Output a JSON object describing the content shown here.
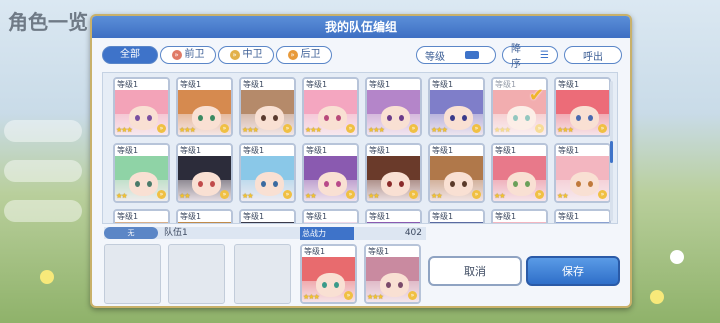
{
  "background": {
    "title": "角色一览"
  },
  "dialog": {
    "title": "我的队伍编组"
  },
  "filter_tabs": [
    {
      "label": "全部",
      "icon": "",
      "active": true
    },
    {
      "label": "前卫",
      "icon": "front-position-icon",
      "active": false
    },
    {
      "label": "中卫",
      "icon": "middle-position-icon",
      "active": false
    },
    {
      "label": "后卫",
      "icon": "back-position-icon",
      "active": false
    }
  ],
  "sort": {
    "sort_by_label": "等级",
    "order_label": "降序",
    "call_out_label": "呼出"
  },
  "level_label": "等级1",
  "character_grid": [
    {
      "hair": "#f3a3b8",
      "eye": "#7a4fa0",
      "stars": "★★★",
      "selected": false
    },
    {
      "hair": "#d68a4f",
      "eye": "#3a8a62",
      "stars": "★★★",
      "selected": false
    },
    {
      "hair": "#b58a6a",
      "eye": "#5a3a2e",
      "stars": "★★★",
      "selected": false
    },
    {
      "hair": "#f4a6c0",
      "eye": "#b84a7a",
      "stars": "★★★",
      "selected": false
    },
    {
      "hair": "#b485c9",
      "eye": "#6b3b8a",
      "stars": "★★★",
      "selected": false
    },
    {
      "hair": "#7f7ec9",
      "eye": "#3a3a8a",
      "stars": "★★★",
      "selected": false
    },
    {
      "hair": "#e86b6e",
      "eye": "#3a9a8a",
      "stars": "★★★",
      "selected": true
    },
    {
      "hair": "#ec6c78",
      "eye": "#4a6ab0",
      "stars": "★★★",
      "selected": false
    },
    {
      "hair": "#8fd3a6",
      "eye": "#4a7a6a",
      "stars": "★★",
      "selected": false
    },
    {
      "hair": "#2c2c3a",
      "eye": "#c04a4a",
      "stars": "★★",
      "selected": false
    },
    {
      "hair": "#8ac8e8",
      "eye": "#3a6aa0",
      "stars": "★★",
      "selected": false
    },
    {
      "hair": "#8a5ab0",
      "eye": "#b84a8a",
      "stars": "★★",
      "selected": false
    },
    {
      "hair": "#6a3a2a",
      "eye": "#8a2a2a",
      "stars": "★★",
      "selected": false
    },
    {
      "hair": "#b0784a",
      "eye": "#5a3a2a",
      "stars": "★★",
      "selected": false
    },
    {
      "hair": "#e8798a",
      "eye": "#6aa05a",
      "stars": "★★",
      "selected": false
    },
    {
      "hair": "#f3b6c0",
      "eye": "#c07a3a",
      "stars": "★★",
      "selected": false
    },
    {
      "hair": "#d9b08a",
      "eye": "#6a4a3a",
      "stars": "",
      "selected": false
    },
    {
      "hair": "#c08a4a",
      "eye": "#6a4a3a",
      "stars": "",
      "selected": false
    },
    {
      "hair": "#3a3a4a",
      "eye": "#6a4a3a",
      "stars": "",
      "selected": false
    },
    {
      "hair": "#f0d8e6",
      "eye": "#6a4a3a",
      "stars": "",
      "selected": false
    },
    {
      "hair": "#8a5ab0",
      "eye": "#6a4a3a",
      "stars": "",
      "selected": false
    },
    {
      "hair": "#5a6aa0",
      "eye": "#6a4a3a",
      "stars": "",
      "selected": false
    },
    {
      "hair": "#f3b6c0",
      "eye": "#6a4a3a",
      "stars": "",
      "selected": false
    },
    {
      "hair": "#8aa0d0",
      "eye": "#6a4a3a",
      "stars": "",
      "selected": false
    }
  ],
  "team": {
    "tag": "无",
    "name": "队伍1",
    "power_label": "总战力",
    "power_value": "402",
    "members": [
      {
        "hair": "#e86b6e",
        "eye": "#3a9a8a",
        "stars": "★★★"
      },
      {
        "hair": "#c98aa0",
        "eye": "#7a4a6a",
        "stars": "★★★"
      }
    ]
  },
  "buttons": {
    "cancel": "取消",
    "save": "保存"
  },
  "colors": {
    "accent": "#3e73c9",
    "frame_gold": "#c9b16a"
  }
}
